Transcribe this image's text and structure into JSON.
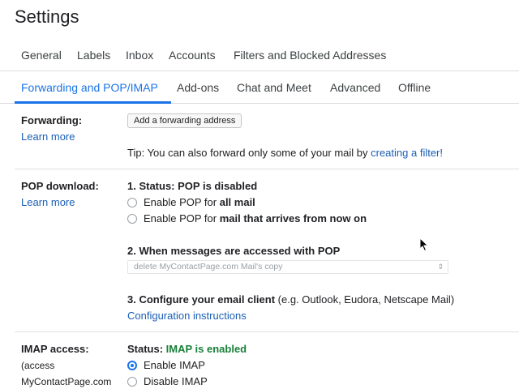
{
  "page": {
    "title": "Settings"
  },
  "tabs_row1": [
    "General",
    "Labels",
    "Inbox",
    "Accounts",
    "Filters and Blocked Addresses"
  ],
  "tabs_row2": [
    "Forwarding and POP/IMAP",
    "Add-ons",
    "Chat and Meet",
    "Advanced",
    "Offline"
  ],
  "active_tab": "Forwarding and POP/IMAP",
  "forwarding": {
    "label": "Forwarding:",
    "learn_more": "Learn more",
    "button": "Add a forwarding address",
    "tip_text": "Tip: You can also forward only some of your mail by ",
    "tip_link": "creating a filter!"
  },
  "pop": {
    "label": "POP download:",
    "learn_more": "Learn more",
    "status_prefix": "1. Status: ",
    "status_value": "POP is disabled",
    "option1_prefix": "Enable POP for ",
    "option1_bold": "all mail",
    "option2_prefix": "Enable POP for ",
    "option2_bold": "mail that arrives from now on",
    "when_accessed": "2. When messages are accessed with POP",
    "select_value": "delete MyContactPage.com Mail's copy",
    "configure_bold": "3. Configure your email client",
    "configure_rest": " (e.g. Outlook, Eudora, Netscape Mail)",
    "config_link": "Configuration instructions"
  },
  "imap": {
    "label": "IMAP access:",
    "sub1": "(access",
    "sub2": "MyContactPage.com",
    "status_prefix": "Status: ",
    "status_value": "IMAP is enabled",
    "enable": "Enable IMAP",
    "disable": "Disable IMAP",
    "enabled": true
  },
  "colors": {
    "accent": "#1a73e8",
    "link": "#1a5fb4",
    "enabled_green": "#188038"
  },
  "icons": {
    "pointer": "mouse-pointer-icon",
    "select_arrow": "updown-chevron-icon"
  }
}
